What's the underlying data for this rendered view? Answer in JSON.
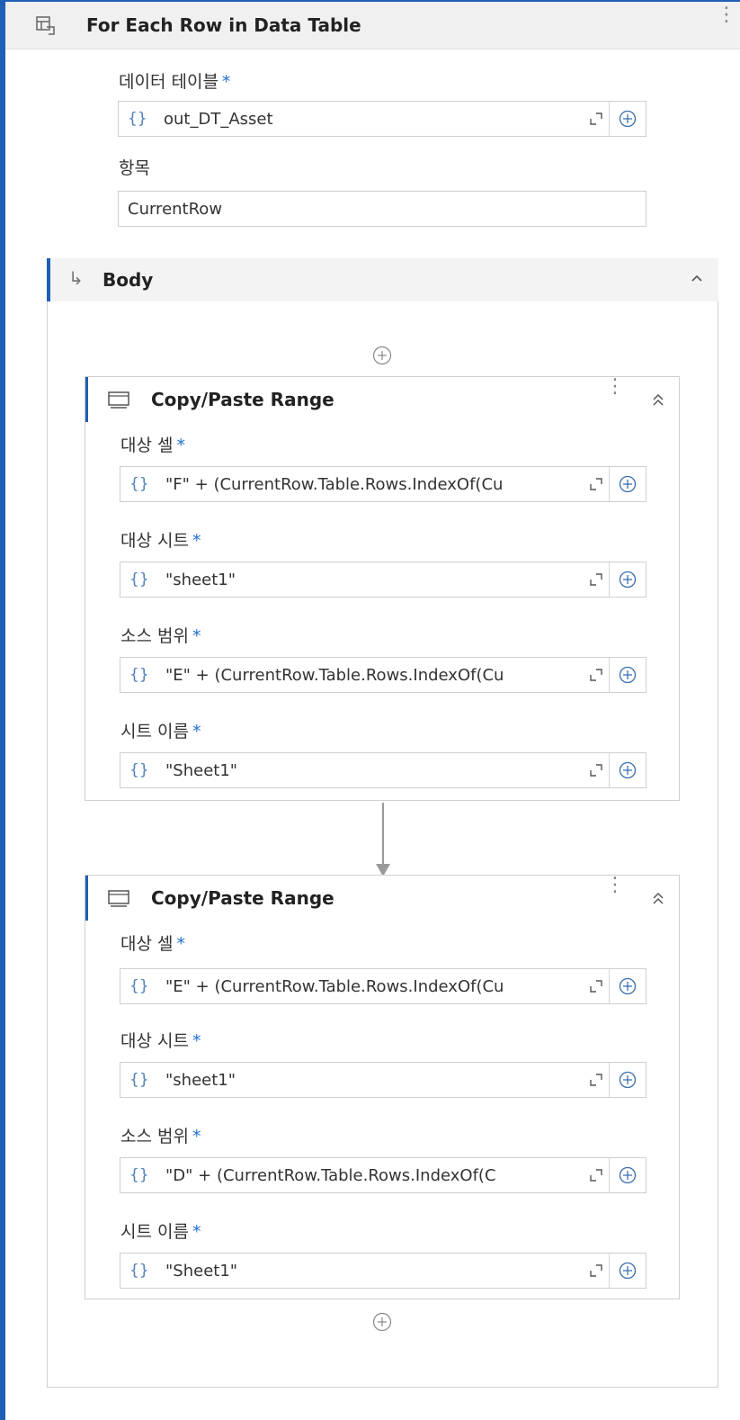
{
  "activity": {
    "title": "For Each Row in Data Table",
    "icon": "table-loop-icon",
    "fields": {
      "datatable_label": "데이터 테이블",
      "datatable_value": "out_DT_Asset",
      "item_label": "항목",
      "item_value": "CurrentRow"
    }
  },
  "required_mark": "*",
  "brace_glyph": "{}",
  "body": {
    "title": "Body"
  },
  "cards": [
    {
      "title": "Copy/Paste Range",
      "fields": [
        {
          "label": "대상 셀",
          "value": "\"F\" + (CurrentRow.Table.Rows.IndexOf(Cu"
        },
        {
          "label": "대상 시트",
          "value": "\"sheet1\""
        },
        {
          "label": "소스 범위",
          "value": "\"E\" + (CurrentRow.Table.Rows.IndexOf(Cu"
        },
        {
          "label": "시트 이름",
          "value": "\"Sheet1\""
        }
      ]
    },
    {
      "title": "Copy/Paste Range",
      "fields": [
        {
          "label": "대상 셀",
          "value": "\"E\" + (CurrentRow.Table.Rows.IndexOf(Cu"
        },
        {
          "label": "대상 시트",
          "value": "\"sheet1\""
        },
        {
          "label": "소스 범위",
          "value": "\"D\" + (CurrentRow.Table.Rows.IndexOf(C"
        },
        {
          "label": "시트 이름",
          "value": "\"Sheet1\""
        }
      ]
    }
  ],
  "colors": {
    "accent": "#1f5fb4",
    "brace": "#4f7fb8",
    "required": "#1e6fd0"
  }
}
